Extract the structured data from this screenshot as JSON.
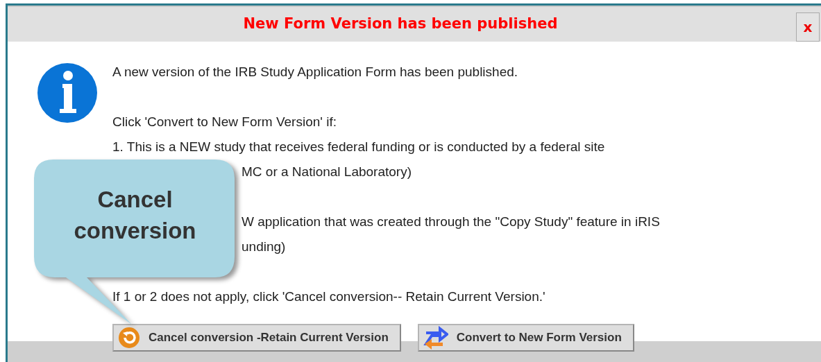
{
  "dialog": {
    "title": "New Form Version has been published",
    "close": "x"
  },
  "paragraphs": [
    {
      "lines": [
        {
          "text": "A new version of the IRB Study Application Form has been published.",
          "kind": "full"
        }
      ]
    },
    {
      "lines": [
        {
          "text": "Click 'Convert to New Form Version' if:",
          "kind": "full"
        },
        {
          "text": "1. This is a NEW study that receives federal funding or is conducted by a federal site",
          "kind": "full"
        },
        {
          "text": "MC or a National Laboratory)",
          "kind": "clipped"
        }
      ]
    },
    {
      "lines": [
        {
          "text": "W application that was created through the \"Copy Study\" feature in iRIS",
          "kind": "clipped"
        },
        {
          "text": "unding)",
          "kind": "clipped"
        }
      ]
    },
    {
      "lines": [
        {
          "text": "If 1 or 2 does not apply, click 'Cancel conversion-- Retain Current Version.'",
          "kind": "full"
        }
      ]
    }
  ],
  "callout": {
    "text": "Cancel conversion"
  },
  "buttons": [
    {
      "label": "Cancel conversion -Retain Current Version",
      "kind": "cancel"
    },
    {
      "label": "Convert to New Form Version",
      "kind": "convert"
    }
  ]
}
